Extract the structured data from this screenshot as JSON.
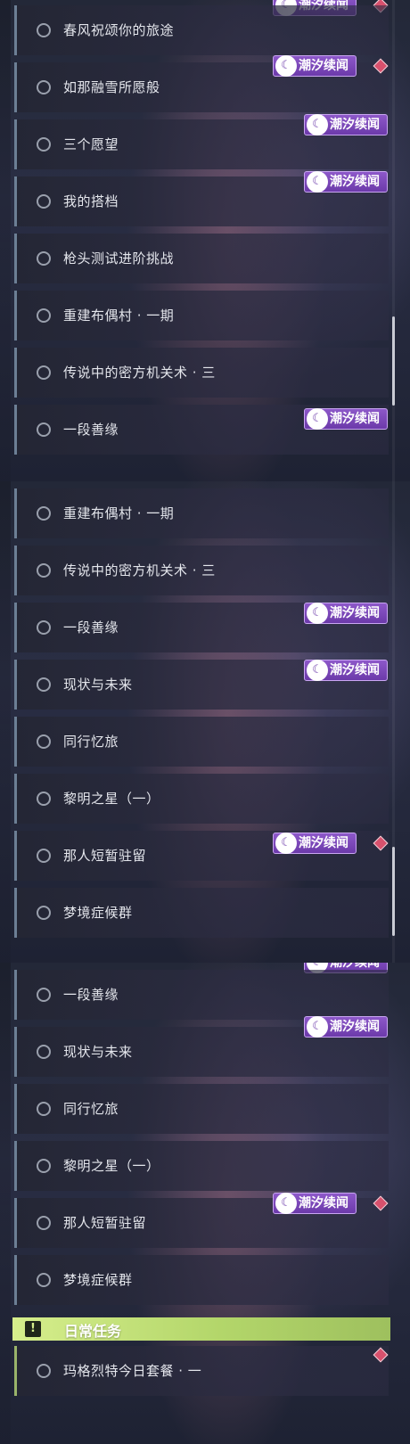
{
  "badge_label": "潮汐续闻",
  "panel1": {
    "rows": [
      {
        "label": "春风祝颂你的旅途"
      },
      {
        "label": "如那融雪所愿般"
      },
      {
        "label": "三个愿望"
      },
      {
        "label": "我的搭档"
      },
      {
        "label": "枪头测试进阶挑战"
      },
      {
        "label": "重建布偶村 · 一期"
      },
      {
        "label": "传说中的密方机关术 · 三"
      },
      {
        "label": "一段善缘"
      }
    ]
  },
  "panel2": {
    "rows": [
      {
        "label": "重建布偶村 · 一期"
      },
      {
        "label": "传说中的密方机关术 · 三"
      },
      {
        "label": "一段善缘"
      },
      {
        "label": "现状与未来"
      },
      {
        "label": "同行忆旅"
      },
      {
        "label": "黎明之星（一）"
      },
      {
        "label": "那人短暂驻留"
      },
      {
        "label": "梦境症候群"
      }
    ]
  },
  "panel3": {
    "rows": [
      {
        "label": "一段善缘"
      },
      {
        "label": "现状与未来"
      },
      {
        "label": "同行忆旅"
      },
      {
        "label": "黎明之星（一）"
      },
      {
        "label": "那人短暂驻留"
      },
      {
        "label": "梦境症候群"
      }
    ],
    "section_header": {
      "title": "日常任务",
      "icon": "!"
    },
    "daily_rows": [
      {
        "label": "玛格烈特今日套餐 · 一"
      }
    ]
  },
  "colors": {
    "accent_purple": "#7a46b8",
    "daily_green": "#c8e37c",
    "alert_red": "#d8516d"
  }
}
